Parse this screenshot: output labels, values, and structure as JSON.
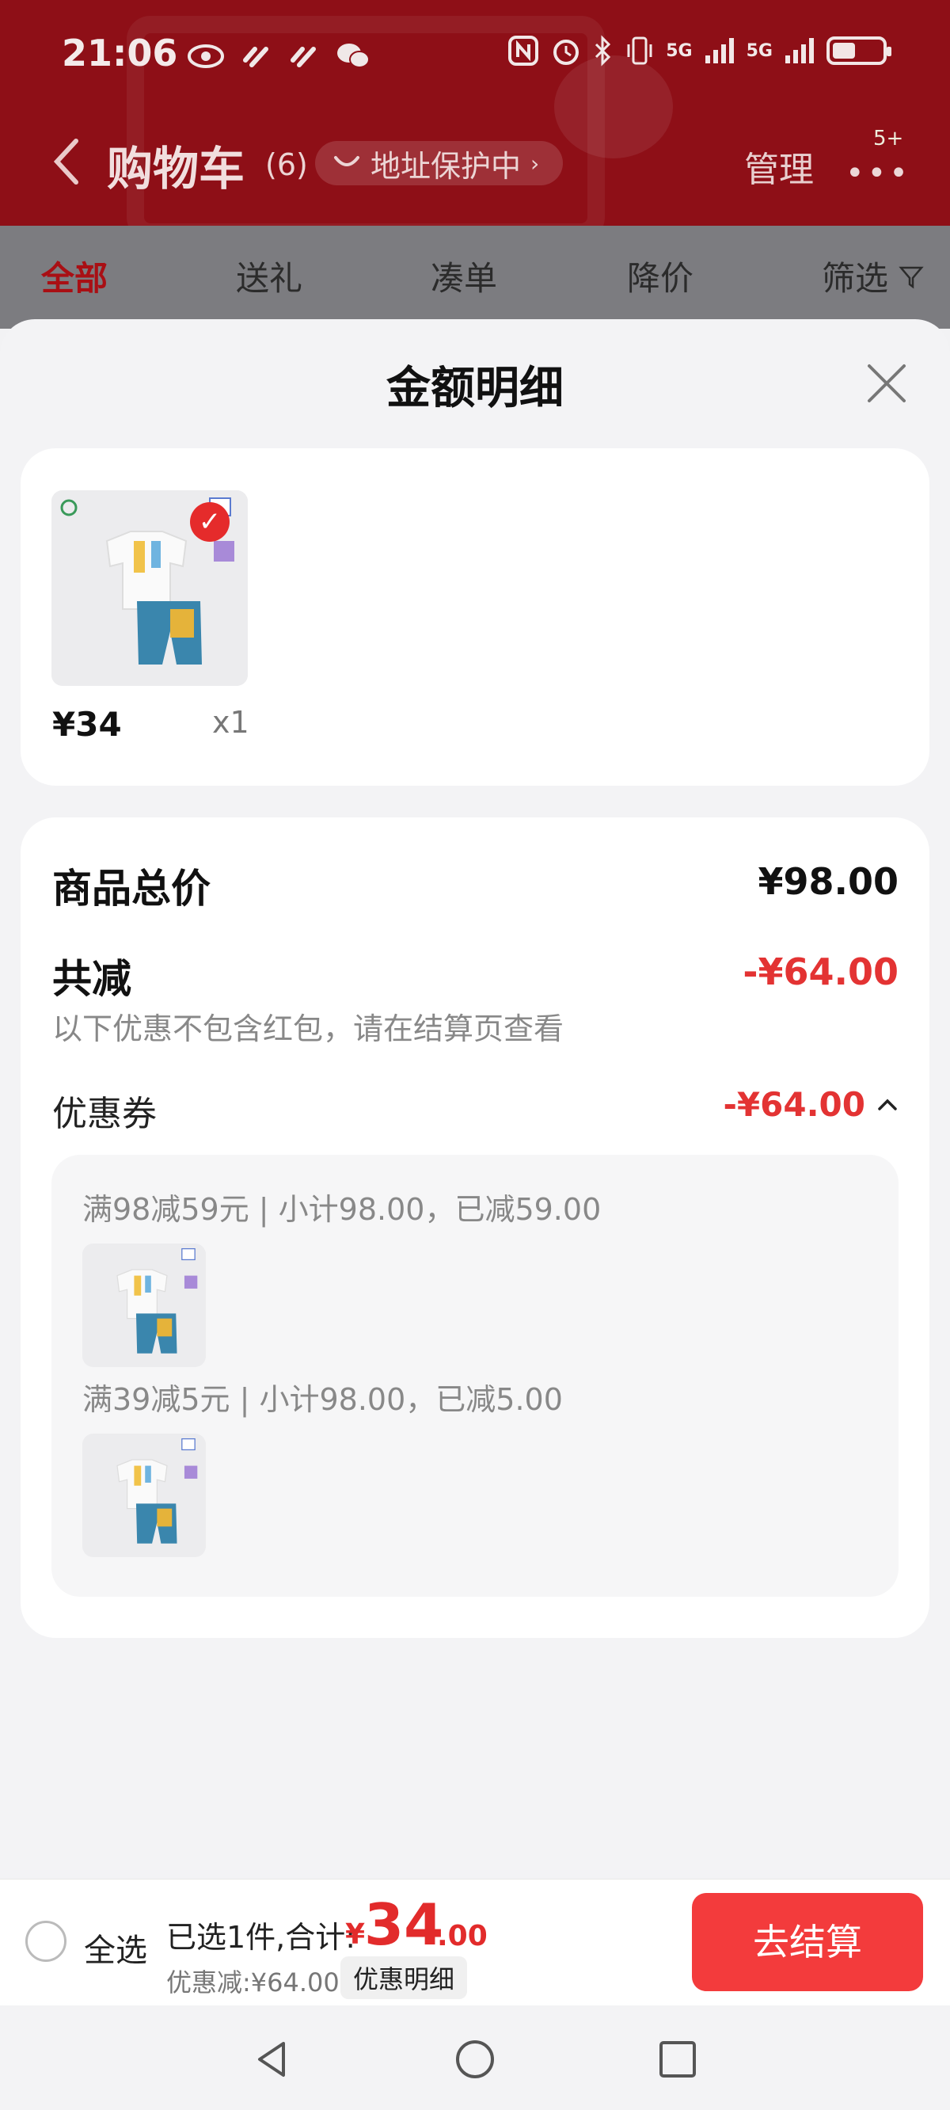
{
  "status": {
    "time": "21:06",
    "network1": "5G",
    "network2": "5G"
  },
  "header": {
    "title": "购物车",
    "count": "(6)",
    "address_pill": "地址保护中",
    "manage": "管理",
    "more_badge": "5+"
  },
  "tabs": [
    "全部",
    "送礼",
    "凑单",
    "降价",
    "筛选"
  ],
  "sheet": {
    "title": "金额明细",
    "item": {
      "price": "¥34",
      "qty": "x1"
    },
    "total_label": "商品总价",
    "total_value": "¥98.00",
    "reduce_label": "共减",
    "reduce_value": "-¥64.00",
    "note": "以下优惠不包含红包，请在结算页查看",
    "coupon_label": "优惠券",
    "coupon_value": "-¥64.00",
    "rules": [
      "满98减59元 | 小计98.00，已减59.00",
      "满39减5元 | 小计98.00，已减5.00"
    ]
  },
  "bottom": {
    "select_all": "全选",
    "selected_text": "已选1件,合计:",
    "currency": "¥",
    "price_int": "34",
    "price_dec": ".00",
    "discount_text": "优惠减:¥64.00",
    "detail_button": "优惠明细",
    "checkout_button": "去结算"
  },
  "colors": {
    "header": "#8e0f17",
    "accent": "#e33333",
    "checkout": "#f33b3c"
  }
}
